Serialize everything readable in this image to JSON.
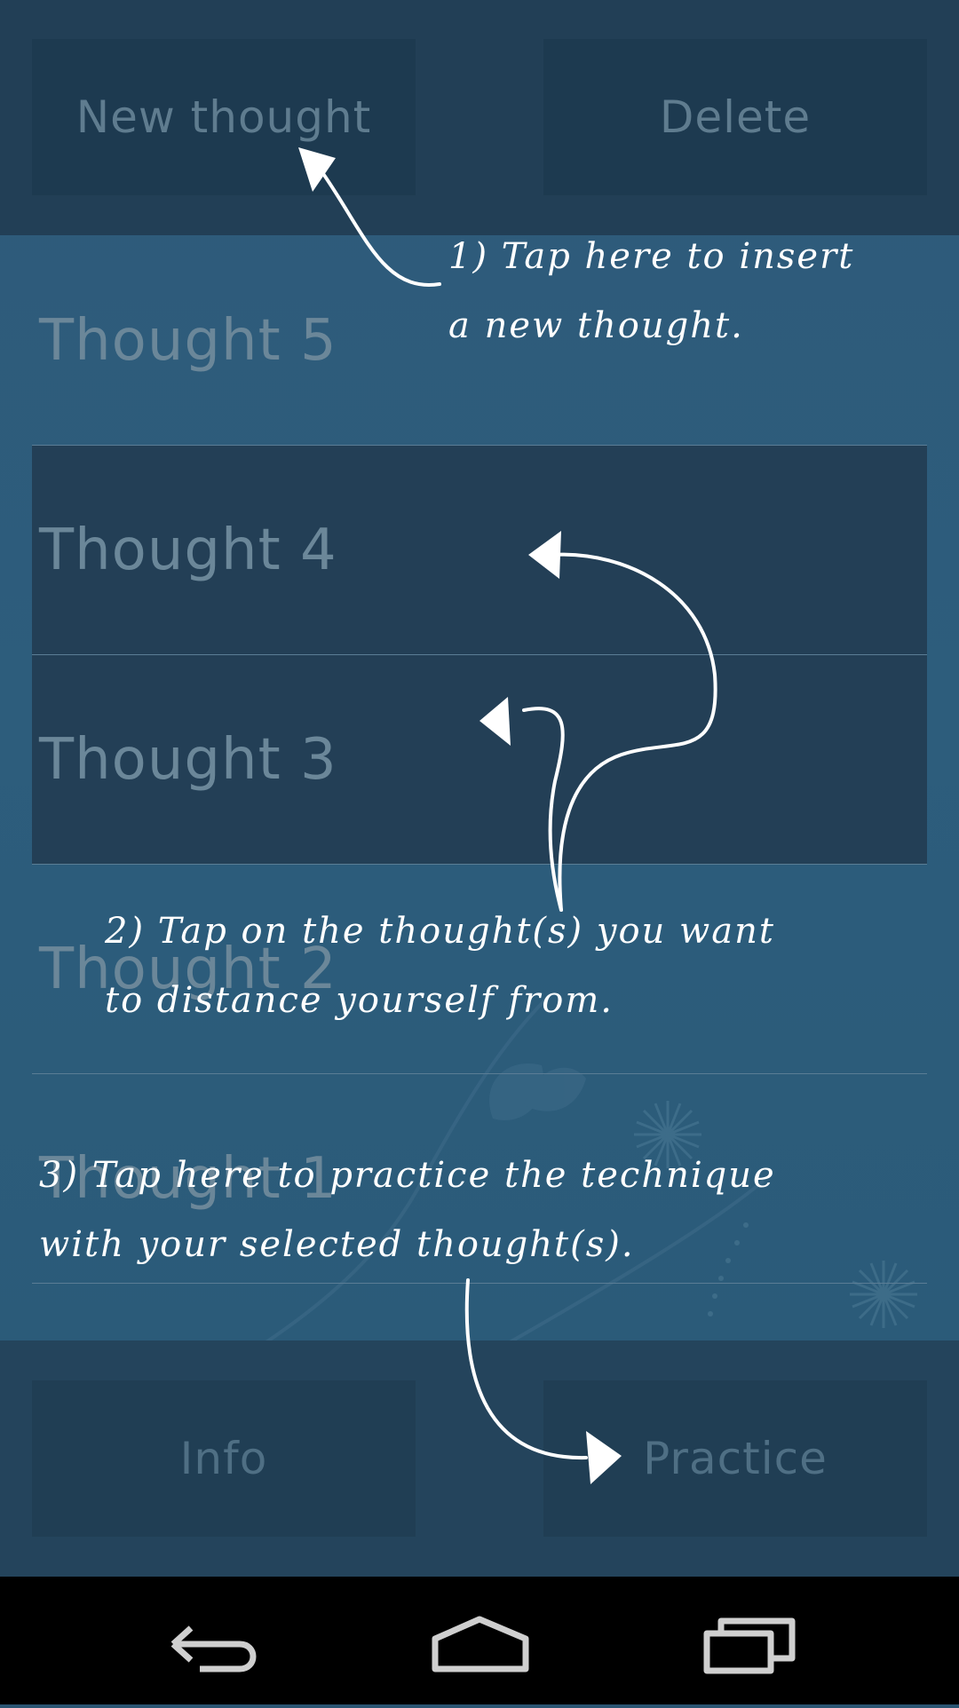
{
  "toolbar": {
    "new_thought_label": "New thought",
    "delete_label": "Delete"
  },
  "thoughts": [
    {
      "label": "Thought 5",
      "selected": false
    },
    {
      "label": "Thought 4",
      "selected": true
    },
    {
      "label": "Thought 3",
      "selected": true
    },
    {
      "label": "Thought 2",
      "selected": false
    },
    {
      "label": "Thought 1",
      "selected": false
    }
  ],
  "bottom": {
    "info_label": "Info",
    "practice_label": "Practice"
  },
  "tutorial": {
    "step1_line1": "1) Tap here to insert",
    "step1_line2": "a new thought.",
    "step2_line1": "2) Tap on the thought(s) you want",
    "step2_line2": "to distance yourself from.",
    "step3_line1": "3) Tap here to practice the technique",
    "step3_line2": "with your selected thought(s)."
  },
  "nav": {
    "back_icon": "back-icon",
    "home_icon": "home-icon",
    "recents_icon": "recents-icon"
  },
  "colors": {
    "background": "#2d5d7c",
    "topbar": "#223f56",
    "button": "#1d3a50",
    "selected_row": "#233f56"
  }
}
